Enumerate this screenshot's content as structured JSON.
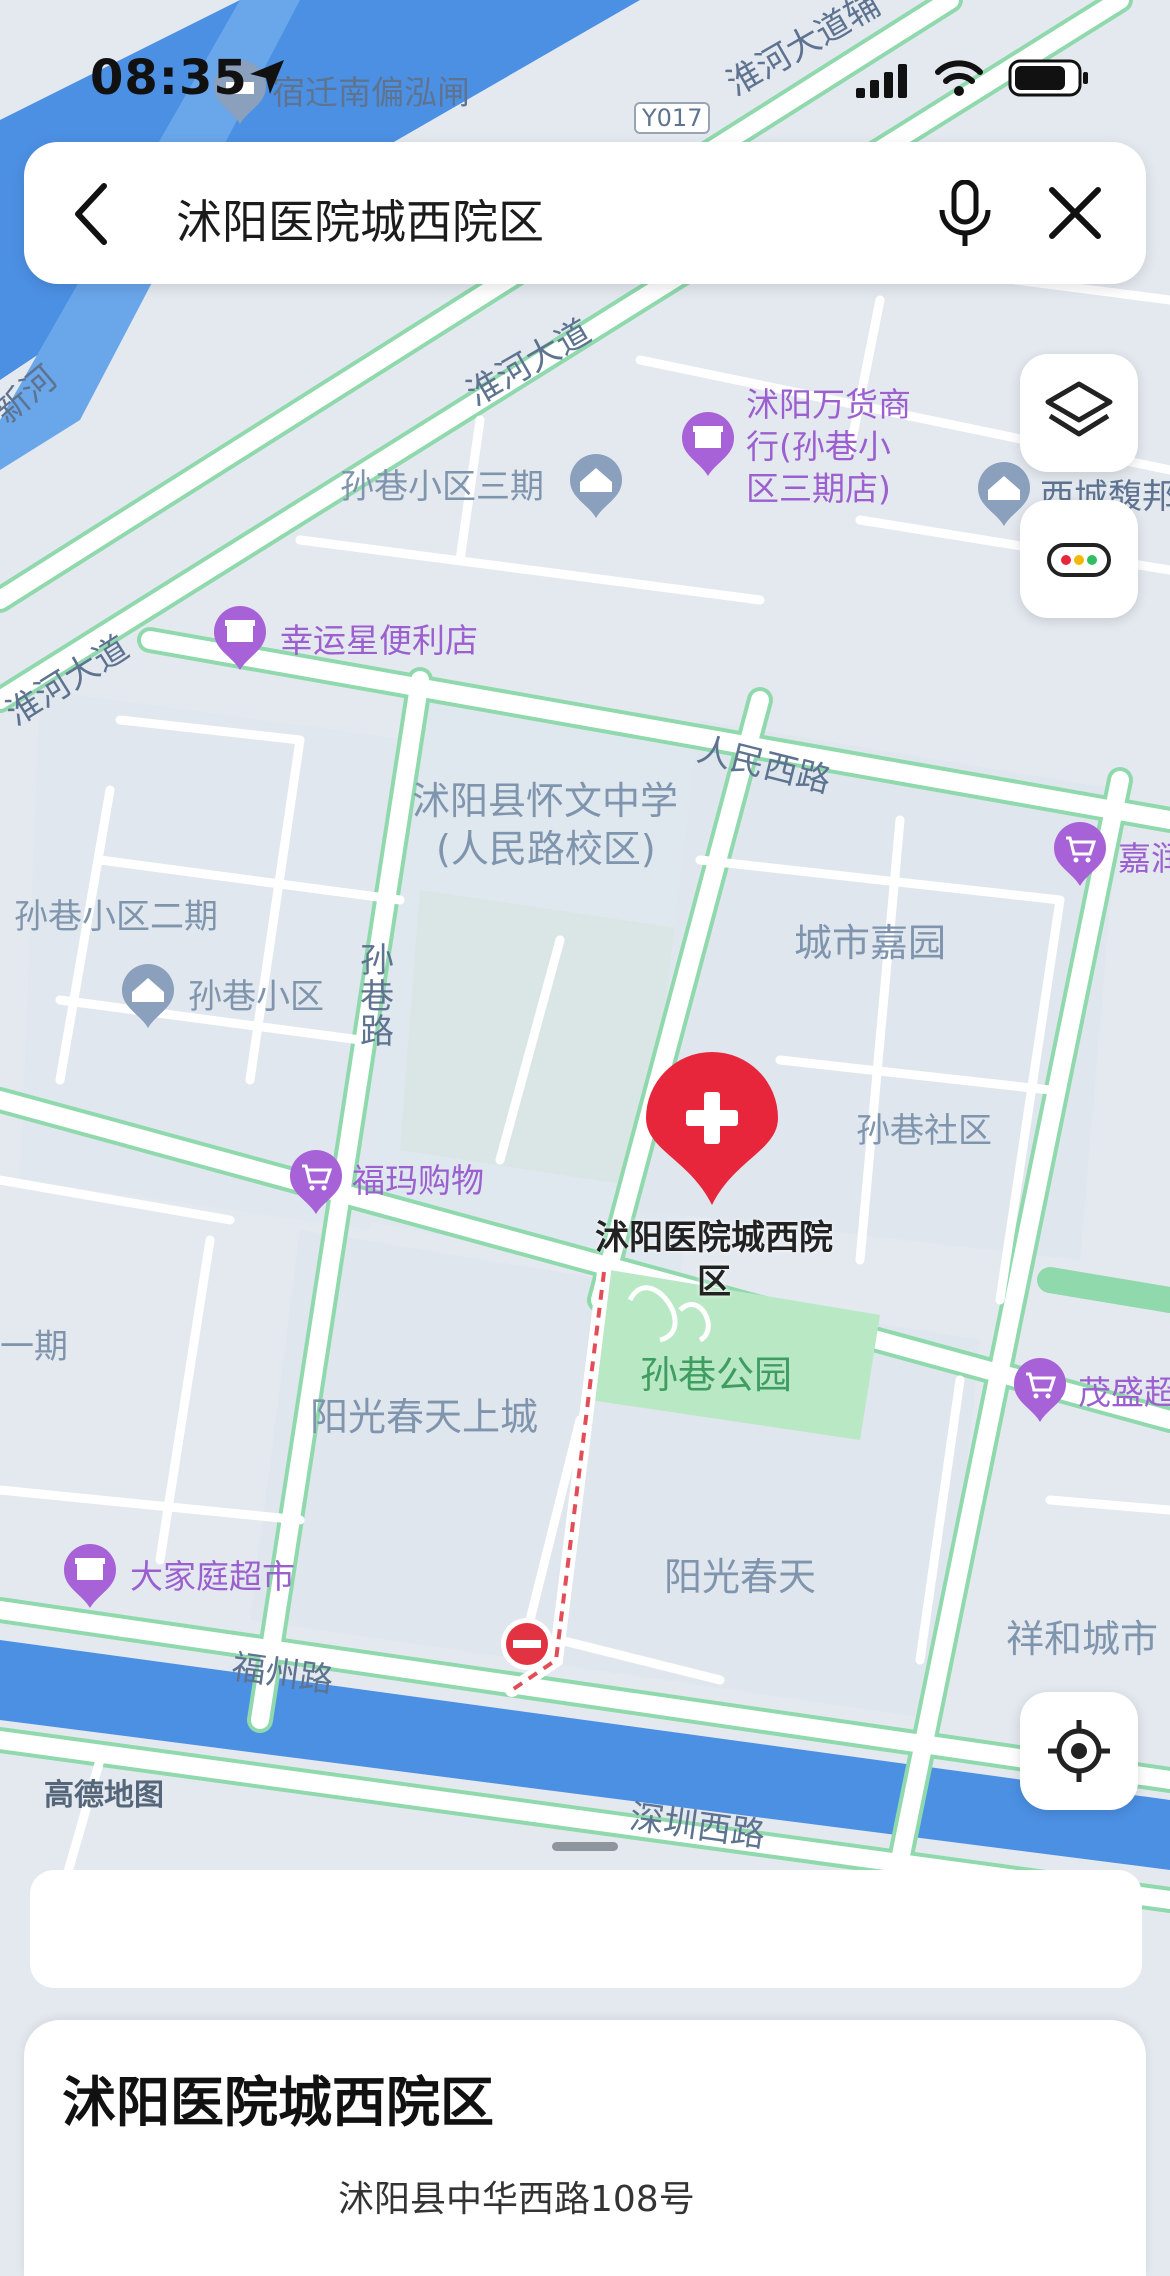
{
  "status_bar": {
    "time": "08:35"
  },
  "search": {
    "query": "沭阳医院城西院区"
  },
  "map": {
    "place_labels": [
      {
        "text": "孙巷小区三期"
      },
      {
        "text": "孙巷小区二期"
      },
      {
        "text": "孙巷小区"
      },
      {
        "text": "沭阳县怀文中学"
      },
      {
        "text": "(人民路校区)"
      },
      {
        "text": "城市嘉园"
      },
      {
        "text": "孙巷社区"
      },
      {
        "text": "阳光春天上城"
      },
      {
        "text": "阳光春天"
      },
      {
        "text": "祥和城市"
      },
      {
        "text": "一期"
      },
      {
        "text": "西城馥邦"
      }
    ],
    "poi_labels": [
      {
        "text": "宿迁南偏泓闸"
      },
      {
        "text": "沭阳万货商"
      },
      {
        "text": "行(孙巷小"
      },
      {
        "text": "区三期店)"
      },
      {
        "text": "幸运星便利店"
      },
      {
        "text": "嘉润"
      },
      {
        "text": "福玛购物"
      },
      {
        "text": "茂盛超"
      },
      {
        "text": "大家庭超市"
      }
    ],
    "road_labels": [
      {
        "text": "淮河大道辅"
      },
      {
        "text": "淮河大道"
      },
      {
        "text": "淮河大道"
      },
      {
        "text": "人民西路"
      },
      {
        "text": "孙巷路"
      },
      {
        "text": "福州路"
      },
      {
        "text": "深圳西路"
      },
      {
        "text": "Y017"
      },
      {
        "text": "新河"
      }
    ],
    "park_label": "孙巷公园",
    "destination_label_line1": "沭阳医院城西院",
    "destination_label_line2": "区",
    "watermark": "高德地图"
  },
  "place_card": {
    "title": "沭阳医院城西院区",
    "address": "沭阳县中华西路108号"
  },
  "colors": {
    "road_fill": "#ffffff",
    "road_edge": "#8fd9ad",
    "river": "#4a8fe3",
    "park": "#b9e8c4",
    "poi_purple": "#a862d8",
    "destination_red": "#e8263b"
  }
}
